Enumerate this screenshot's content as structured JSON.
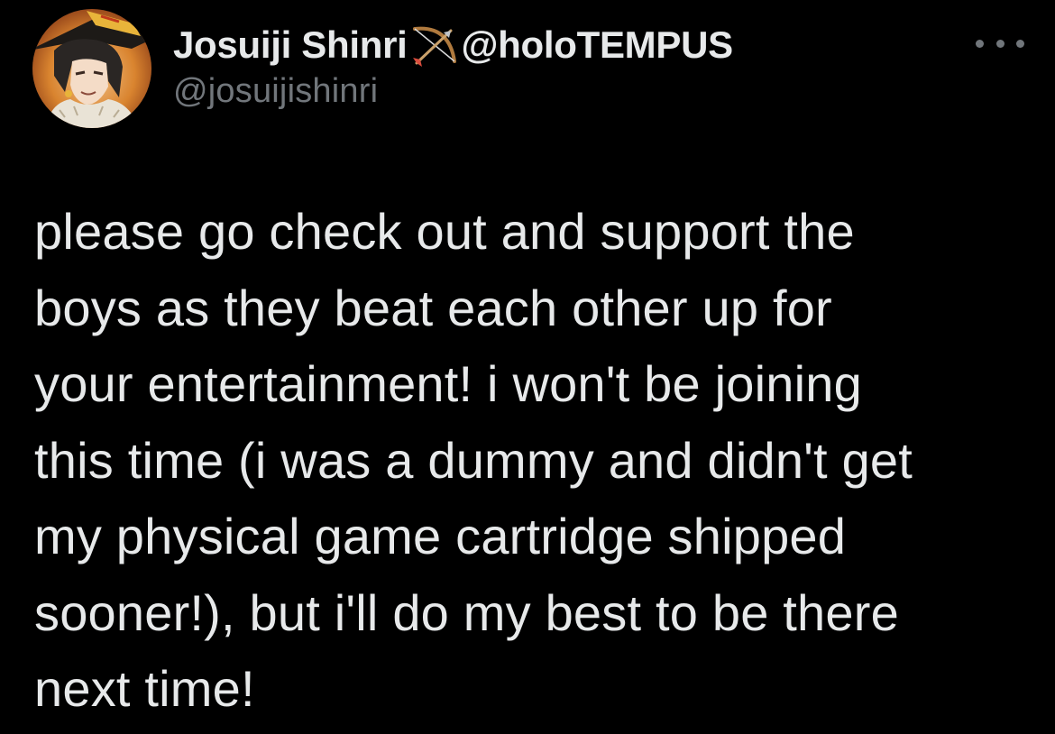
{
  "tweet": {
    "author": {
      "display_name": "Josuiji Shinri",
      "name_emoji": "bow-and-arrow-icon",
      "affiliation_handle": "@holoTEMPUS",
      "handle": "@josuijishinri"
    },
    "more_menu_icon": "more-dots-icon",
    "text": "please go check out and support the\nboys as they beat each other up for\nyour entertainment! i won't be joining\nthis time (i was a dummy and didn't get\nmy physical game cartridge shipped\nsooner!), but i'll do my best to be there\nnext time!"
  },
  "colors": {
    "background": "#000000",
    "primary_text": "#e7e9ea",
    "secondary_text": "#71767b"
  }
}
